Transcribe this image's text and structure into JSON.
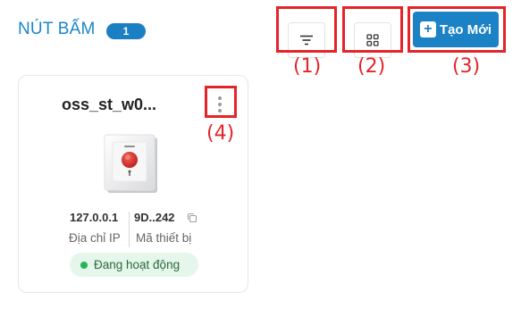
{
  "header": {
    "title": "NÚT BẤM",
    "count": "1",
    "filter_icon": "filter-lines-icon",
    "grid_icon": "grid-view-icon",
    "create_label": "Tạo Mới",
    "create_icon": "plus-icon"
  },
  "annotations": [
    "(1)",
    "(2)",
    "(3)",
    "(4)"
  ],
  "device": {
    "name": "oss_st_w0...",
    "menu_icon": "more-vertical-icon",
    "image": "wall-push-button-icon",
    "ip": "127.0.0.1",
    "ip_label": "Địa chỉ IP",
    "code": "9D..242",
    "code_label": "Mã thiết bị",
    "copy_icon": "copy-icon",
    "status": "Đang hoạt động",
    "status_color": "#27b456"
  },
  "colors": {
    "accent": "#1b82c6",
    "annotation": "#e5242a"
  }
}
